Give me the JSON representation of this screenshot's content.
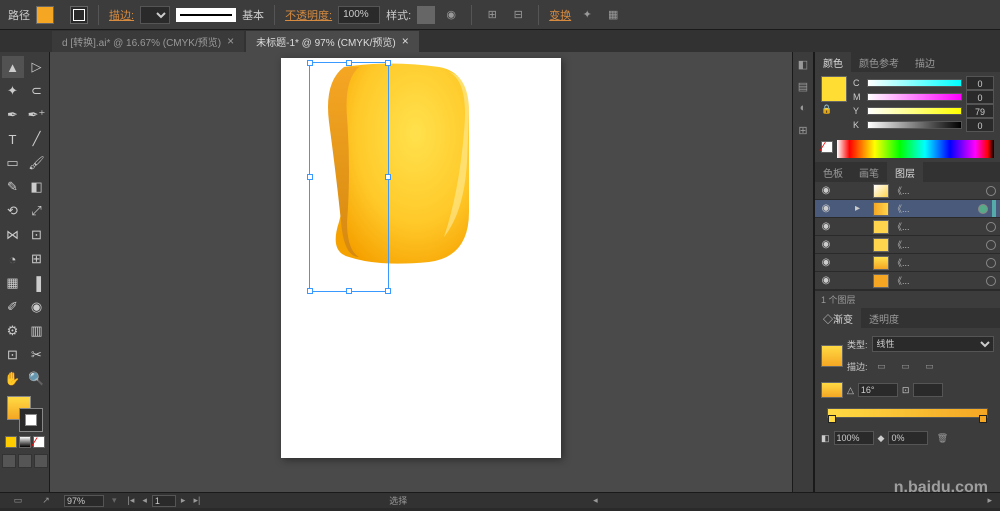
{
  "control": {
    "path_label": "路径",
    "fill_color": "#f5a623",
    "stroke_label": "描边:",
    "stroke_preset": "基本",
    "opacity_label": "不透明度:",
    "opacity_value": "100%",
    "style_label": "样式:",
    "transform_label": "变换"
  },
  "tabs": [
    {
      "label": "d [转换].ai* @ 16.67% (CMYK/预览)",
      "active": false
    },
    {
      "label": "未标题-1* @ 97% (CMYK/预览)",
      "active": true
    }
  ],
  "color_panel": {
    "tabs": [
      "颜色",
      "颜色参考",
      "描边"
    ],
    "c": "0",
    "m": "0",
    "y": "79",
    "k": "0",
    "labels": {
      "c": "C",
      "m": "M",
      "y": "Y",
      "k": "K"
    }
  },
  "layers_panel": {
    "tabs": [
      "色板",
      "画笔",
      "图层"
    ],
    "items": [
      {
        "name": "《...",
        "sel": false
      },
      {
        "name": "《...",
        "sel": true
      },
      {
        "name": "《...",
        "sel": false
      },
      {
        "name": "《...",
        "sel": false
      },
      {
        "name": "《...",
        "sel": false
      },
      {
        "name": "《...",
        "sel": false
      }
    ],
    "footer": "1 个图层"
  },
  "gradient_panel": {
    "tabs": [
      "◇渐变",
      "透明度"
    ],
    "type_label": "类型:",
    "type_value": "线性",
    "stroke_label": "描边:",
    "angle_value": "16°",
    "opacity_value": "100%",
    "loc_value": "0%"
  },
  "status": {
    "zoom": "97%",
    "artboard": "1",
    "mode": "选择"
  },
  "watermark": "n.baidu.com"
}
